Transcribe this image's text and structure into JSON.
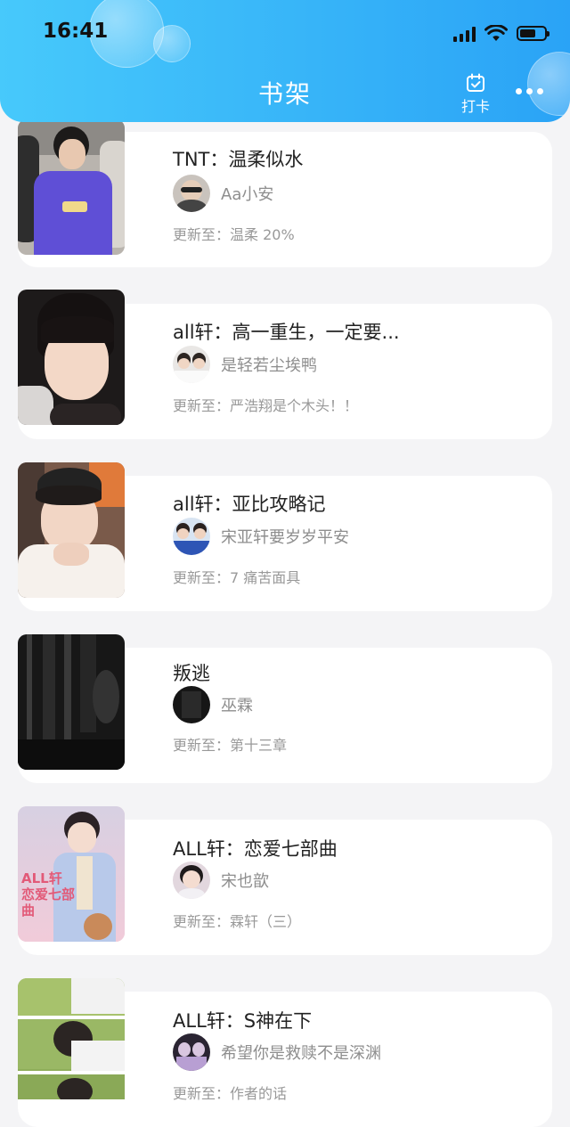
{
  "status_bar": {
    "time": "16:41"
  },
  "header": {
    "title": "书架",
    "checkin_label": "打卡"
  },
  "books": [
    {
      "title": "TNT：温柔似水",
      "author": "Aa小安",
      "update": "更新至：温柔 20%"
    },
    {
      "title": "all轩：高一重生，一定要...",
      "author": "是轻若尘埃鸭",
      "update": "更新至：严浩翔是个木头！！"
    },
    {
      "title": "all轩：亚比攻略记",
      "author": "宋亚轩要岁岁平安",
      "update": "更新至：7 痛苦面具"
    },
    {
      "title": "叛逃",
      "author": "巫霖",
      "update": "更新至：第十三章"
    },
    {
      "title": "ALL轩：恋爱七部曲",
      "author": "宋也歆",
      "update": "更新至：霖轩（三）",
      "cover_text": "ALL轩 恋爱七部曲"
    },
    {
      "title": "ALL轩：S神在下",
      "author": "希望你是救赎不是深渊",
      "update": "更新至：作者的话"
    }
  ],
  "colors": {
    "header_start": "#47c9fb",
    "header_end": "#2aa3f6",
    "background": "#f4f4f6"
  }
}
